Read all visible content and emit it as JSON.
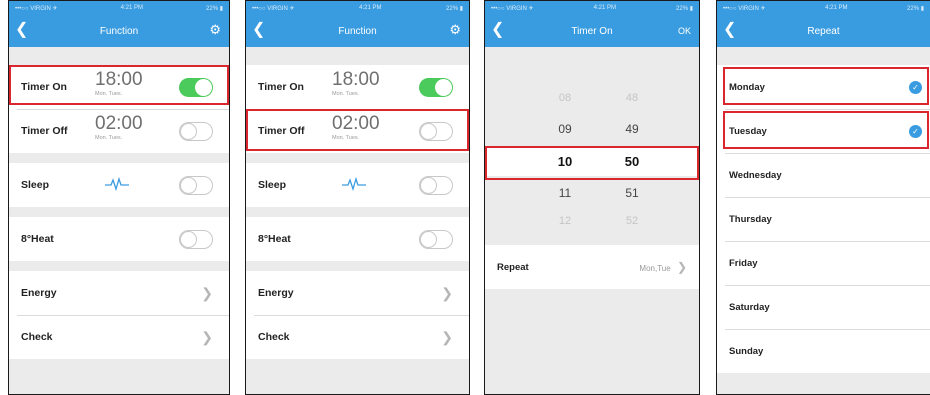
{
  "status": {
    "carrier": "•••○○ VIRGIN ✈",
    "time": "4:21 PM",
    "battery": "22% ▮"
  },
  "screen1": {
    "title": "Function",
    "timer_on": {
      "label": "Timer On",
      "time": "18:00",
      "days": "Mon. Tues.",
      "toggle": "on"
    },
    "timer_off": {
      "label": "Timer Off",
      "time": "02:00",
      "days": "Mon. Tues.",
      "toggle": "off"
    },
    "sleep": {
      "label": "Sleep",
      "toggle": "off"
    },
    "heat": {
      "label": "8°Heat",
      "toggle": "off"
    },
    "energy": {
      "label": "Energy"
    },
    "check": {
      "label": "Check"
    }
  },
  "screen2": {
    "title": "Function",
    "timer_on": {
      "label": "Timer On",
      "time": "18:00",
      "days": "Mon. Tues.",
      "toggle": "on"
    },
    "timer_off": {
      "label": "Timer Off",
      "time": "02:00",
      "days": "Mon. Tues.",
      "toggle": "off"
    },
    "sleep": {
      "label": "Sleep",
      "toggle": "off"
    },
    "heat": {
      "label": "8°Heat",
      "toggle": "off"
    },
    "energy": {
      "label": "Energy"
    },
    "check": {
      "label": "Check"
    }
  },
  "screen3": {
    "title": "Timer On",
    "ok": "OK",
    "hours": [
      "08",
      "09",
      "10",
      "11",
      "12"
    ],
    "minutes": [
      "48",
      "49",
      "50",
      "51",
      "52"
    ],
    "selected_hour": "10",
    "selected_minute": "50",
    "repeat_label": "Repeat",
    "repeat_value": "Mon,Tue"
  },
  "screen4": {
    "title": "Repeat",
    "days": [
      {
        "label": "Monday",
        "checked": true
      },
      {
        "label": "Tuesday",
        "checked": true
      },
      {
        "label": "Wednesday",
        "checked": false
      },
      {
        "label": "Thursday",
        "checked": false
      },
      {
        "label": "Friday",
        "checked": false
      },
      {
        "label": "Saturday",
        "checked": false
      },
      {
        "label": "Sunday",
        "checked": false
      }
    ]
  },
  "colors": {
    "nav": "#3a9ce0",
    "toggle_on": "#4bcb5b",
    "highlight": "#d9262f"
  },
  "icons": {
    "back": "chevron-left-icon",
    "settings": "gear-icon",
    "sleep": "pulse-wave-icon",
    "arrow": "chevron-right-icon",
    "check": "checkmark-circle-icon"
  }
}
